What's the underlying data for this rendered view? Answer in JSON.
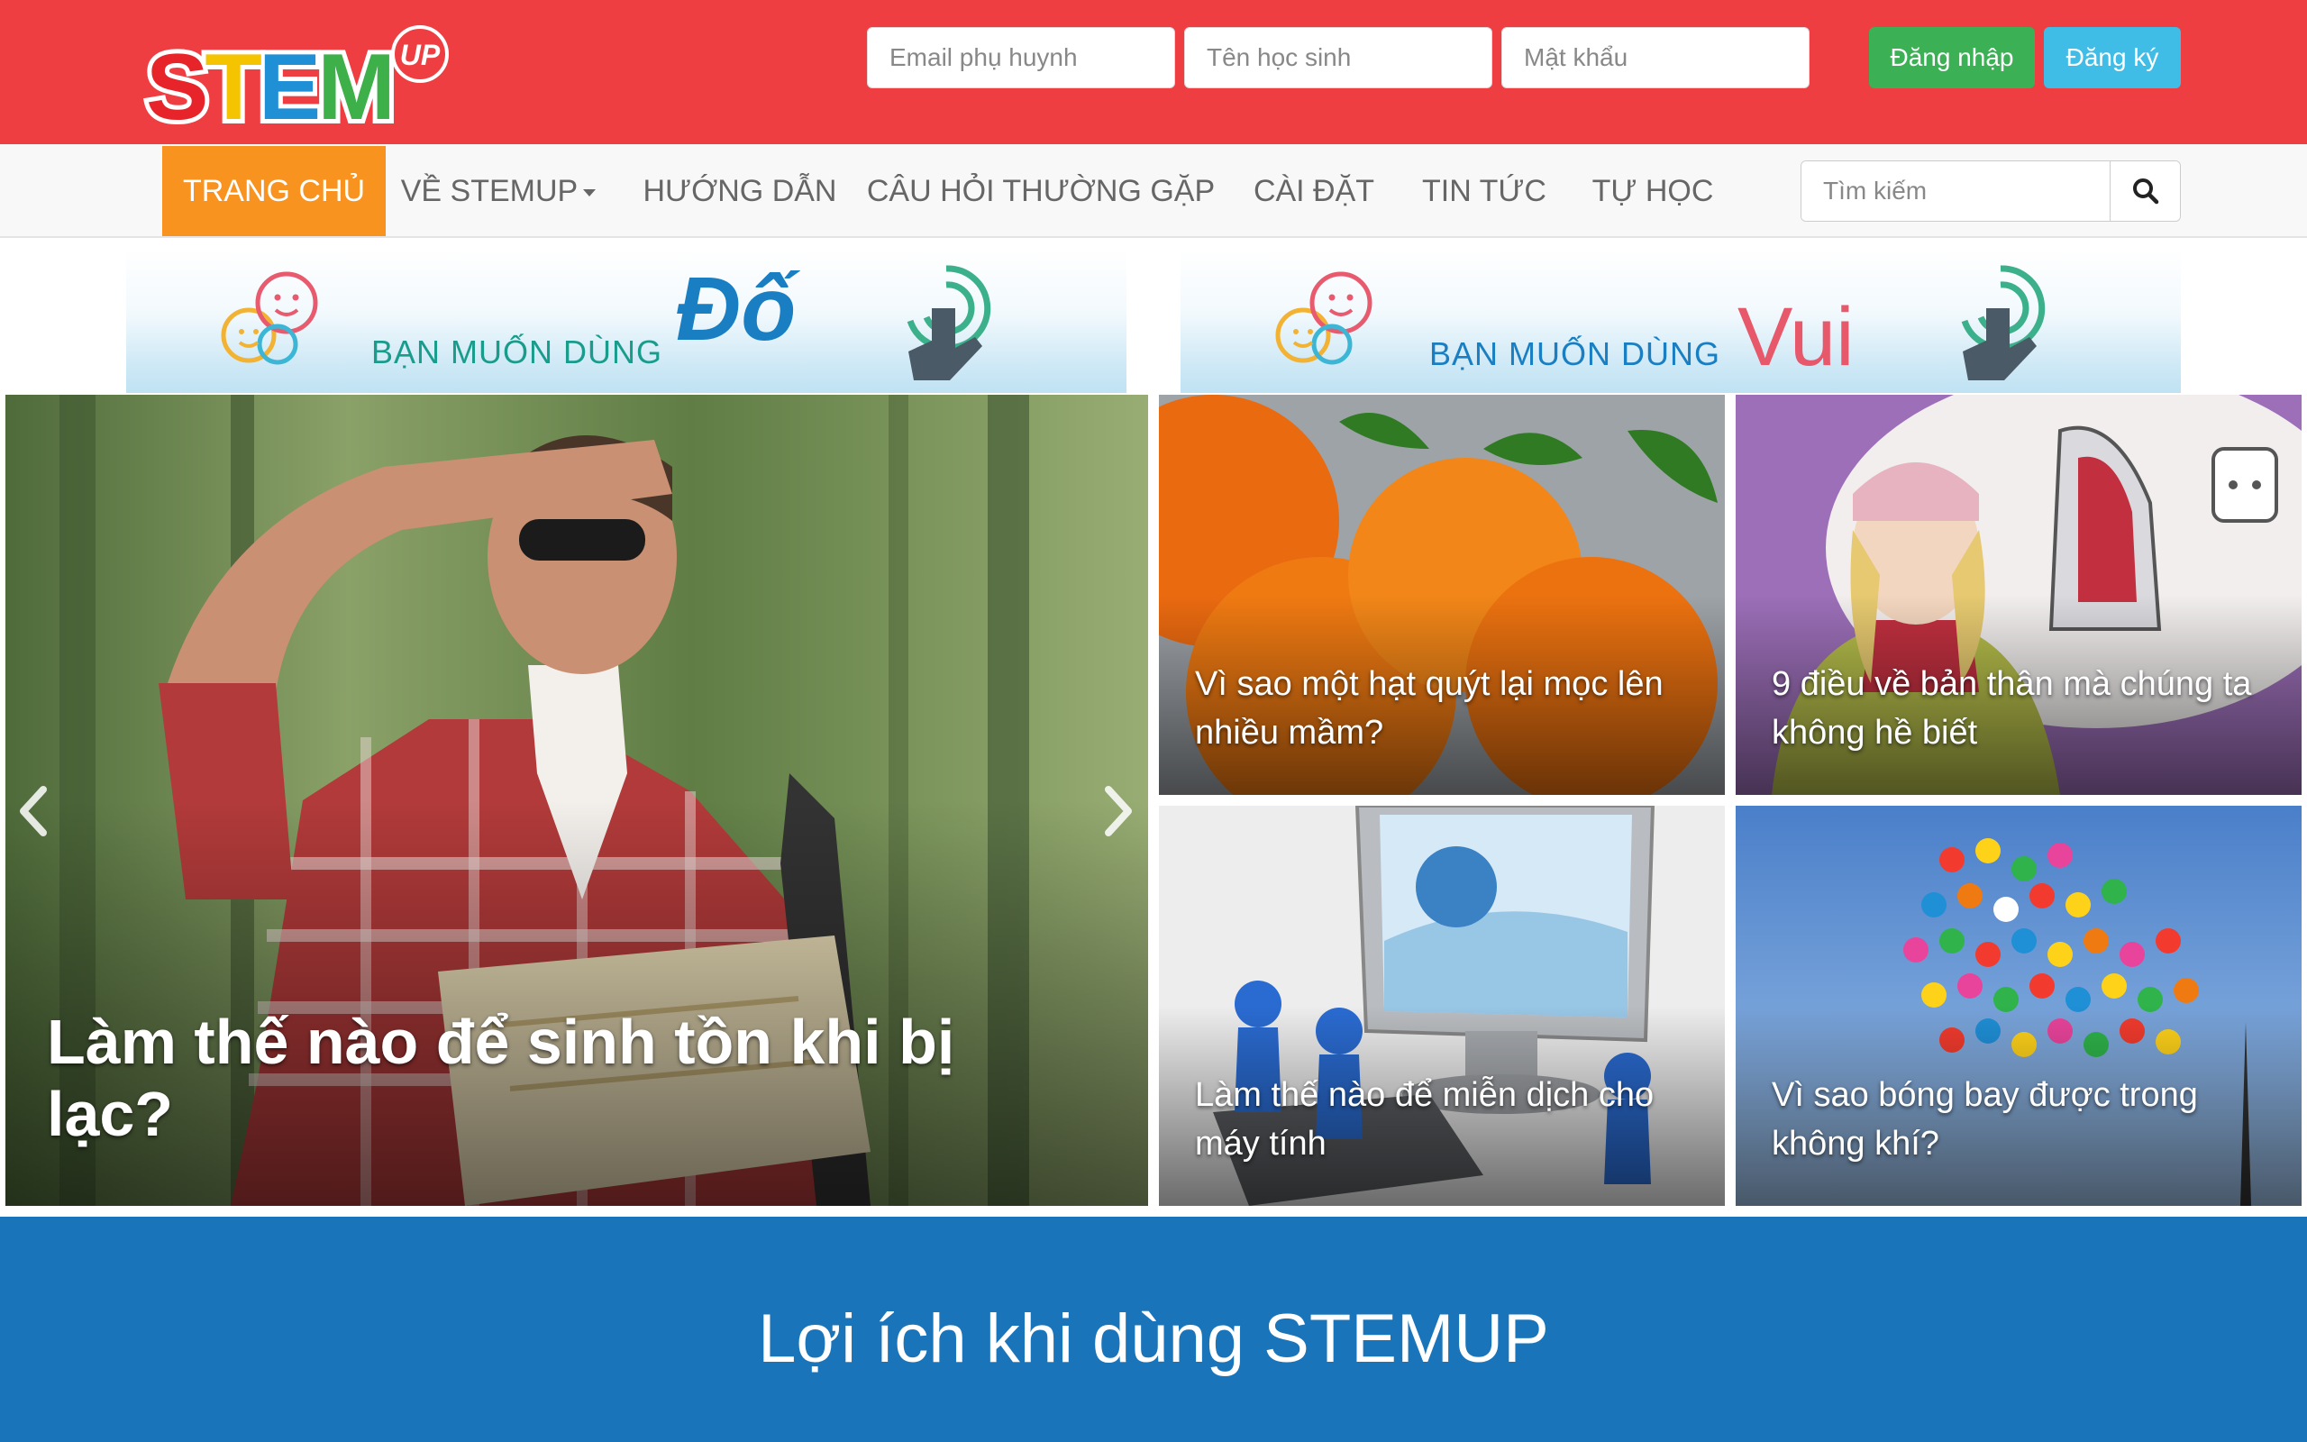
{
  "logo": {
    "main_text": "STEM",
    "badge_text": "UP"
  },
  "login": {
    "email_placeholder": "Email phụ huynh",
    "student_placeholder": "Tên học sinh",
    "password_placeholder": "Mật khẩu",
    "login_label": "Đăng nhập",
    "register_label": "Đăng ký"
  },
  "nav": {
    "items": [
      {
        "label": "TRANG CHỦ",
        "active": true
      },
      {
        "label": "VỀ STEMUP",
        "dropdown": true
      },
      {
        "label": "HƯỚNG DẪN"
      },
      {
        "label": "CÂU HỎI THƯỜNG GẶP"
      },
      {
        "label": "CÀI ĐẶT"
      },
      {
        "label": "TIN TỨC"
      },
      {
        "label": "TỰ HỌC"
      }
    ],
    "search_placeholder": "Tìm kiếm"
  },
  "banners": [
    {
      "text": "BẠN MUỐN DÙNG",
      "word": "Đố"
    },
    {
      "text": "BẠN MUỐN DÙNG",
      "word": "Vui"
    }
  ],
  "articles": [
    {
      "title": "Làm thế nào để sinh tồn khi bị lạc?"
    },
    {
      "title": "Vì sao một hạt quýt lại mọc lên nhiều mầm?"
    },
    {
      "title": "9 điều về bản thân mà chúng ta không hề biết"
    },
    {
      "title": "Làm thế nào để miễn dịch cho máy tính"
    },
    {
      "title": "Vì sao bóng bay được trong không khí?"
    }
  ],
  "benefits": {
    "title": "Lợi ích khi dùng STEMUP"
  },
  "colors": {
    "header_red": "#ef3e42",
    "nav_active_orange": "#f7931e",
    "login_green": "#3cb054",
    "register_blue": "#3fbde7",
    "benefits_blue": "#1a74ba"
  }
}
